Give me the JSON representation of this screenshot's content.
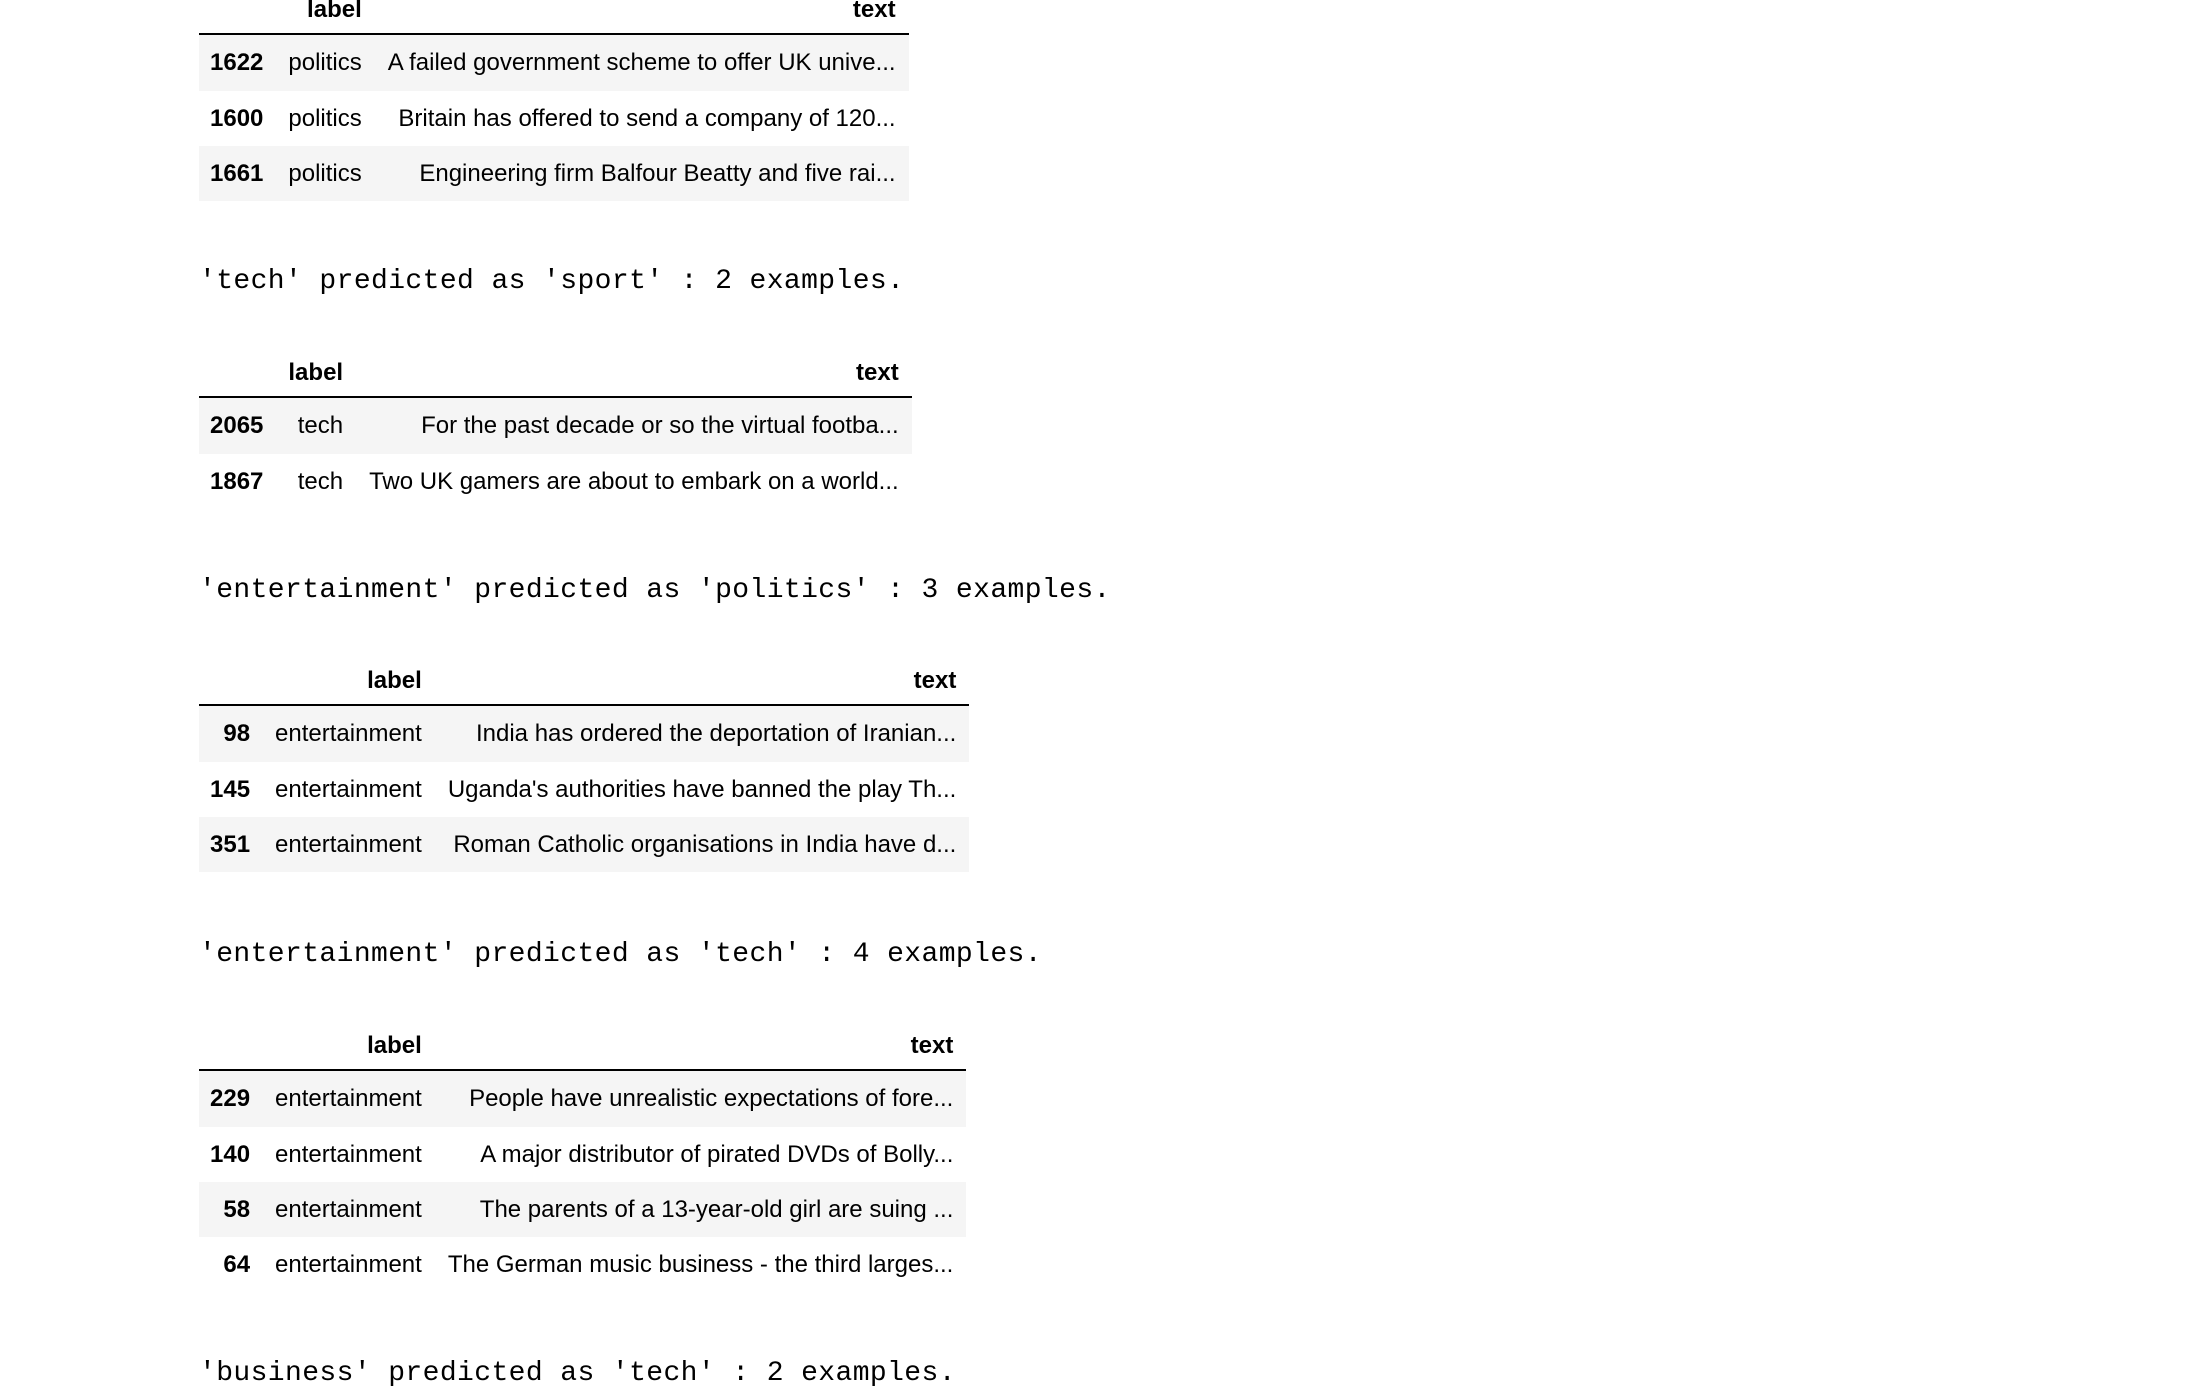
{
  "tables": [
    {
      "columns": [
        "label",
        "text"
      ],
      "rows": [
        {
          "index": "1622",
          "label": "politics",
          "text": "A failed government scheme to offer UK unive..."
        },
        {
          "index": "1600",
          "label": "politics",
          "text": "Britain has offered to send a company of 120..."
        },
        {
          "index": "1661",
          "label": "politics",
          "text": "Engineering firm Balfour Beatty and five rai..."
        }
      ]
    },
    {
      "columns": [
        "label",
        "text"
      ],
      "rows": [
        {
          "index": "2065",
          "label": "tech",
          "text": "For the past decade or so the virtual footba..."
        },
        {
          "index": "1867",
          "label": "tech",
          "text": "Two UK gamers are about to embark on a world..."
        }
      ]
    },
    {
      "columns": [
        "label",
        "text"
      ],
      "rows": [
        {
          "index": "98",
          "label": "entertainment",
          "text": "India has ordered the deportation of Iranian..."
        },
        {
          "index": "145",
          "label": "entertainment",
          "text": "Uganda's authorities have banned the play Th..."
        },
        {
          "index": "351",
          "label": "entertainment",
          "text": "Roman Catholic organisations in India have d..."
        }
      ]
    },
    {
      "columns": [
        "label",
        "text"
      ],
      "rows": [
        {
          "index": "229",
          "label": "entertainment",
          "text": "People have unrealistic expectations of fore..."
        },
        {
          "index": "140",
          "label": "entertainment",
          "text": "A major distributor of pirated DVDs of Bolly..."
        },
        {
          "index": "58",
          "label": "entertainment",
          "text": "The parents of a 13-year-old girl are suing ..."
        },
        {
          "index": "64",
          "label": "entertainment",
          "text": "The German music business - the third larges..."
        }
      ]
    }
  ],
  "captions": [
    "'tech' predicted as 'sport' : 2 examples.",
    "'entertainment' predicted as 'politics' : 3 examples.",
    "'entertainment' predicted as 'tech' : 4 examples.",
    "'business' predicted as 'tech' : 2 examples."
  ]
}
